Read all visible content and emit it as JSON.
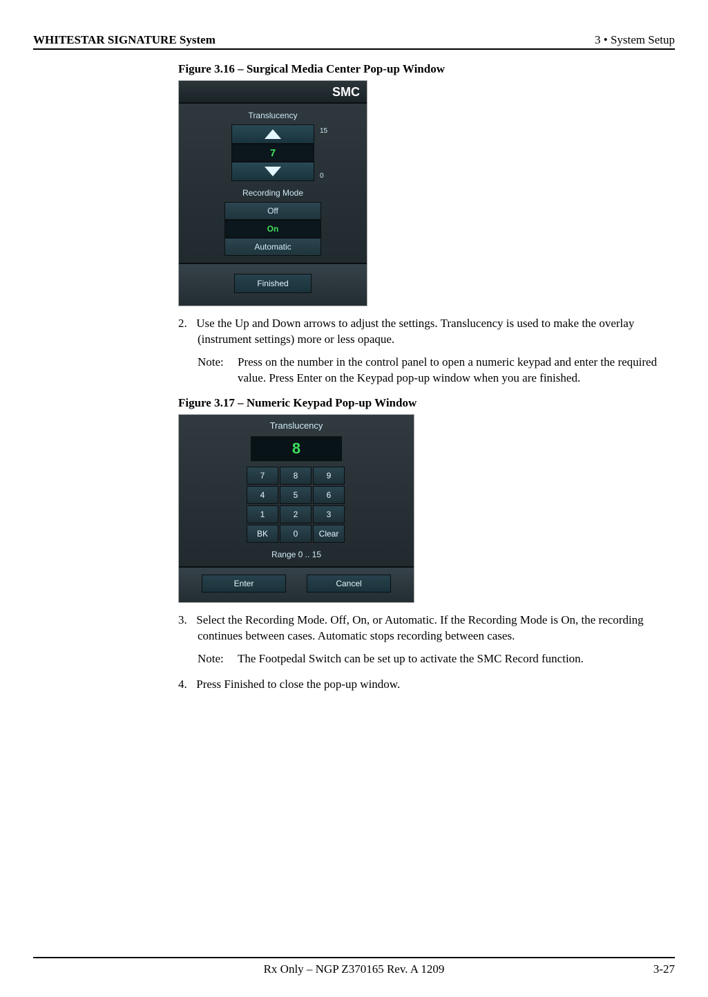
{
  "header": {
    "left": "WHITESTAR SIGNATURE System",
    "right": "3  • System Setup"
  },
  "figure316": {
    "caption": "Figure 3.16 – Surgical Media Center Pop-up Window",
    "smc": {
      "title": "SMC",
      "translucency_label": "Translucency",
      "max": "15",
      "value": "7",
      "min": "0",
      "recording_mode_label": "Recording Mode",
      "modes": {
        "off": "Off",
        "on": "On",
        "automatic": "Automatic"
      },
      "finished": "Finished"
    }
  },
  "step2": {
    "num": "2.",
    "text": "Use the Up and Down arrows to adjust the settings. Translucency is used to make the overlay (instrument settings) more or less opaque."
  },
  "note1": {
    "label": "Note:",
    "text": "Press on the number in the control panel to open a numeric keypad and enter the required value. Press Enter on the Keypad pop-up window when you are finished."
  },
  "figure317": {
    "caption": "Figure 3.17 – Numeric Keypad Pop-up Window",
    "keypad": {
      "title": "Translucency",
      "value": "8",
      "keys": [
        [
          "7",
          "8",
          "9"
        ],
        [
          "4",
          "5",
          "6"
        ],
        [
          "1",
          "2",
          "3"
        ],
        [
          "BK",
          "0",
          "Clear"
        ]
      ],
      "range": "Range 0 .. 15",
      "enter": "Enter",
      "cancel": "Cancel"
    }
  },
  "step3": {
    "num": "3.",
    "text": "Select the Recording Mode. Off, On, or Automatic. If the Recording Mode is On, the recording continues between cases. Automatic stops recording between cases."
  },
  "note2": {
    "label": "Note:",
    "text": "The Footpedal Switch can be set up to activate the SMC Record function."
  },
  "step4": {
    "num": "4.",
    "text": "Press Finished to close the pop-up window."
  },
  "footer": {
    "center": "Rx Only – NGP Z370165 Rev. A 1209",
    "right": "3-27"
  }
}
